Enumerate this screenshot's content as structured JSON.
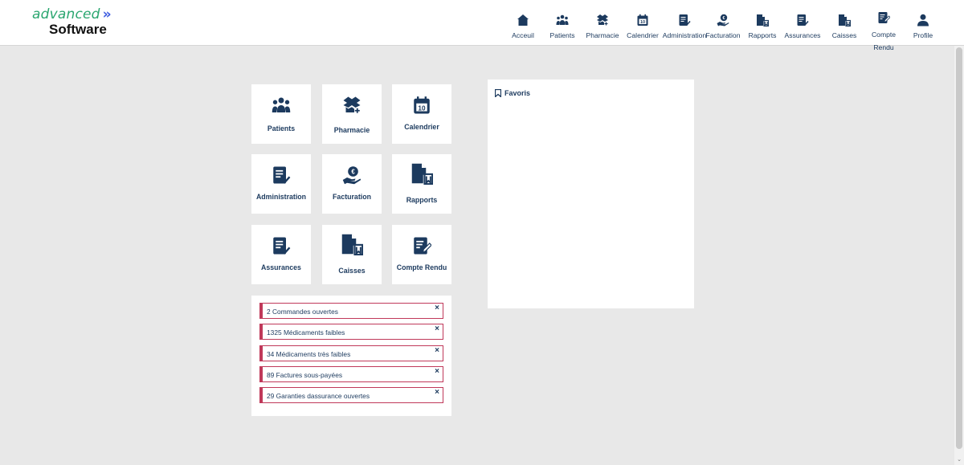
{
  "logo": {
    "top": "advanced",
    "arrows": "»",
    "bottom": "Software"
  },
  "nav": [
    {
      "label": "Acceuil",
      "icon": "home-icon"
    },
    {
      "label": "Patients",
      "icon": "patients-icon"
    },
    {
      "label": "Pharmacie",
      "icon": "pharmacy-icon"
    },
    {
      "label": "Calendrier",
      "icon": "calendar-icon"
    },
    {
      "label": "Administration",
      "icon": "administration-icon"
    },
    {
      "label": "Facturation",
      "icon": "billing-icon"
    },
    {
      "label": "Rapports",
      "icon": "reports-icon"
    },
    {
      "label": "Assurances",
      "icon": "insurance-icon"
    },
    {
      "label": "Caisses",
      "icon": "cash-register-icon"
    },
    {
      "label": "Compte\nRendu",
      "line1": "Compte",
      "line2": "Rendu",
      "icon": "report-edit-icon"
    },
    {
      "label": "Profile",
      "icon": "user-icon"
    }
  ],
  "calendar_number": "10",
  "tiles": [
    {
      "label": "Patients",
      "icon": "patients-icon"
    },
    {
      "label": "Pharmacie",
      "icon": "pharmacy-icon"
    },
    {
      "label": "Calendrier",
      "icon": "calendar-icon"
    },
    {
      "label": "Administration",
      "icon": "administration-icon"
    },
    {
      "label": "Facturation",
      "icon": "billing-icon"
    },
    {
      "label": "Rapports",
      "icon": "reports-icon"
    },
    {
      "label": "Assurances",
      "icon": "insurance-icon"
    },
    {
      "label": "Caisses",
      "icon": "cash-register-icon"
    },
    {
      "label": "Compte Rendu",
      "icon": "report-edit-icon"
    }
  ],
  "alerts": [
    {
      "text": "2 Commandes ouvertes",
      "close": "×"
    },
    {
      "text": "1325 Médicaments faibles",
      "close": "×"
    },
    {
      "text": "34 Médicaments très faibles",
      "close": "×"
    },
    {
      "text": "89 Factures sous-payées",
      "close": "×"
    },
    {
      "text": "29 Garanties dassurance ouvertes",
      "close": "×"
    }
  ],
  "favoris": {
    "title": "Favoris",
    "icon": "bookmark-icon"
  },
  "colors": {
    "primary": "#1c3a5e",
    "alert": "#c0395a",
    "logo_green": "#2aa66f",
    "logo_blue": "#3f5de0",
    "background": "#e8e8e8"
  }
}
